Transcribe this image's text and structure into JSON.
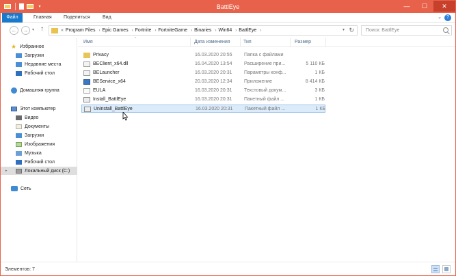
{
  "window": {
    "title": "BattlEye",
    "quick_access": {
      "dropdown_glyph": "▾"
    },
    "controls": {
      "minimize": "—",
      "maximize": "☐",
      "close": "✕"
    }
  },
  "ribbon": {
    "tabs": [
      "Файл",
      "Главная",
      "Поделиться",
      "Вид"
    ],
    "expand_glyph": "⌄",
    "help_glyph": "?"
  },
  "navigation": {
    "back_glyph": "←",
    "forward_glyph": "→",
    "recent_glyph": "▾",
    "up_glyph": "↑",
    "address_lead": "«",
    "breadcrumbs": [
      "Program Files",
      "Epic Games",
      "Fortnite",
      "FortniteGame",
      "Binaries",
      "Win64",
      "BattlEye"
    ],
    "crumb_separator": "›",
    "address_dropdown_glyph": "▾",
    "refresh_glyph": "↻",
    "search_placeholder": "Поиск: BattlEye"
  },
  "sidebar": {
    "favorites": {
      "label": "Избранное",
      "items": [
        "Загрузки",
        "Недавние места",
        "Рабочий стол"
      ]
    },
    "homegroup": {
      "label": "Домашняя группа"
    },
    "computer": {
      "label": "Этот компьютер",
      "items": [
        "Видео",
        "Документы",
        "Загрузки",
        "Изображения",
        "Музыка",
        "Рабочий стол",
        "Локальный диск (C:)"
      ]
    },
    "network": {
      "label": "Сеть"
    },
    "expander_glyph": "▸"
  },
  "columns": {
    "name": "Имя",
    "date": "Дата изменения",
    "type": "Тип",
    "size": "Размер",
    "sort_glyph": "^"
  },
  "files": [
    {
      "name": "Privacy",
      "date": "16.03.2020 20:55",
      "type": "Папка с файлами",
      "size": "",
      "icon": "folder-icon"
    },
    {
      "name": "BEClient_x64.dll",
      "date": "16.04.2020 13:54",
      "type": "Расширение при...",
      "size": "5 110 КБ",
      "icon": "dll-icon"
    },
    {
      "name": "BELauncher",
      "date": "16.03.2020 20:31",
      "type": "Параметры конф...",
      "size": "1 КБ",
      "icon": "config-icon"
    },
    {
      "name": "BEService_x64",
      "date": "20.03.2020 12:34",
      "type": "Приложение",
      "size": "8 414 КБ",
      "icon": "exe-icon"
    },
    {
      "name": "EULA",
      "date": "16.03.2020 20:31",
      "type": "Текстовый докум...",
      "size": "3 КБ",
      "icon": "text-file-icon"
    },
    {
      "name": "Install_BattlEye",
      "date": "16.03.2020 20:31",
      "type": "Пакетный файл ...",
      "size": "1 КБ",
      "icon": "batch-file-icon"
    },
    {
      "name": "Uninstall_BattlEye",
      "date": "16.03.2020 20:31",
      "type": "Пакетный файл ...",
      "size": "1 КБ",
      "icon": "batch-file-icon"
    }
  ],
  "status": {
    "text": "Элементов: 7"
  },
  "colors": {
    "title_bar": "#e8624b",
    "file_tab": "#1979ca",
    "selection": "#dcebfa",
    "folder": "#e8c55a"
  }
}
